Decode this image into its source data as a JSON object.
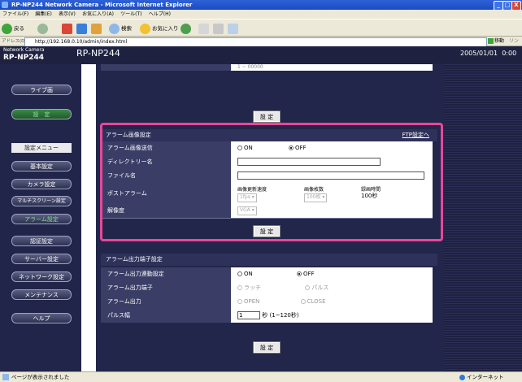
{
  "window": {
    "title": "RP-NP244 Network Camera - Microsoft Internet Explorer",
    "controls": [
      "_",
      "□",
      "X"
    ]
  },
  "menu": [
    "ファイル(F)",
    "編集(E)",
    "表示(V)",
    "お気に入り(A)",
    "ツール(T)",
    "ヘルプ(H)"
  ],
  "toolbar": {
    "back": "戻る",
    "search": "検索",
    "favorites": "お気に入り"
  },
  "address": {
    "label": "アドレス(D)",
    "url": "http://192.168.0.10/admin/index.html",
    "go": "移動",
    "links": "リンク"
  },
  "camera": {
    "brand_small": "Network Camera",
    "brand_model": "RP-NP244",
    "model_title": "RP-NP244",
    "datetime": "2005/01/01  0:00"
  },
  "nav": {
    "live": "ライブ画",
    "setup": "設　定",
    "menu_label": "設定メニュー",
    "items": [
      "基本設定",
      "カメラ設定",
      "マルチスクリーン設定",
      "アラーム設定",
      "認証設定",
      "サーバー設定",
      "ネットワーク設定",
      "メンテナンス",
      "ヘルプ"
    ]
  },
  "top_partial": {
    "field_value": "1  ~  00000"
  },
  "set_button": "設 定",
  "alarm_image": {
    "title": "アラーム画像設定",
    "ftp_link": "FTP設定へ",
    "rows": {
      "send_label": "アラーム画像送信",
      "on": "ON",
      "off": "OFF",
      "dir_label": "ディレクトリー名",
      "file_label": "ファイル名",
      "post_label": "ポストアラーム",
      "rate_head": "画像更新速度",
      "rate_val": "1fps",
      "count_head": "画像枚数",
      "count_val": "100枚",
      "time_head": "録画時間",
      "time_val": "100秒",
      "res_label": "解像度",
      "res_val": "VGA"
    }
  },
  "alarm_output": {
    "title": "アラーム出力端子設定",
    "rows": {
      "link_label": "アラーム出力連動設定",
      "on": "ON",
      "off": "OFF",
      "terminal_label": "アラーム出力端子",
      "latch": "ラッチ",
      "pulse": "パルス",
      "output_label": "アラーム出力",
      "open": "OPEN",
      "close": "CLOSE",
      "width_label": "パルス幅",
      "width_val": "1",
      "width_unit": "秒 (1~120秒)"
    }
  },
  "status": {
    "left": "ページが表示されました",
    "right": "インターネット"
  }
}
